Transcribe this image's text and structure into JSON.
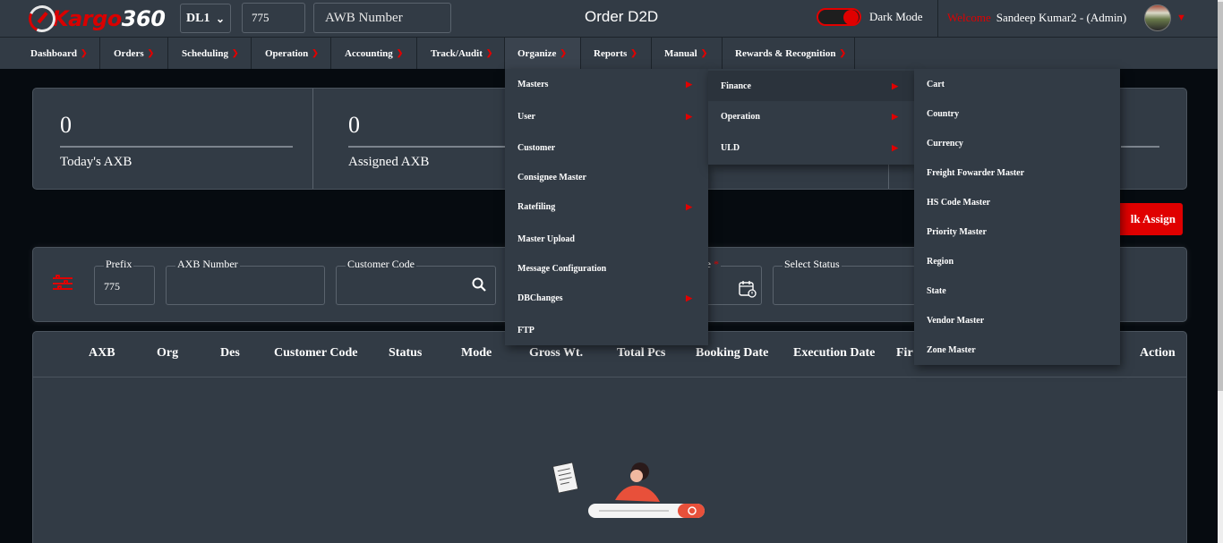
{
  "brand": {
    "logo_text_a": "Kargo",
    "logo_text_b": "360"
  },
  "header": {
    "station": "DL1",
    "prefix": "775",
    "awb_placeholder": "AWB Number",
    "page_title": "Order D2D",
    "dark_mode_label": "Dark Mode",
    "welcome": "Welcome",
    "user": "Sandeep Kumar2 - (Admin)"
  },
  "nav": [
    {
      "label": "Dashboard"
    },
    {
      "label": "Orders"
    },
    {
      "label": "Scheduling"
    },
    {
      "label": "Operation"
    },
    {
      "label": "Accounting"
    },
    {
      "label": "Track/Audit"
    },
    {
      "label": "Organize"
    },
    {
      "label": "Reports"
    },
    {
      "label": "Manual"
    },
    {
      "label": "Rewards & Recognition"
    }
  ],
  "stats": [
    {
      "value": "0",
      "label": "Today's AXB"
    },
    {
      "value": "0",
      "label": "Assigned AXB"
    }
  ],
  "bulk_assign": "lk Assign",
  "filters": {
    "prefix_label": "Prefix",
    "prefix_value": "775",
    "axb_label": "AXB Number",
    "customer_label": "Customer Code",
    "date_label": "ate",
    "required_mark": "*",
    "status_label": "Select Status"
  },
  "table": {
    "headers": [
      "AXB",
      "Org",
      "Des",
      "Customer Code",
      "Status",
      "Mode",
      "Gross Wt.",
      "Total Pcs",
      "Booking Date",
      "Execution Date",
      "Fir",
      "Action"
    ]
  },
  "menu_organize": [
    {
      "label": "Masters",
      "sub": true
    },
    {
      "label": "User",
      "sub": true
    },
    {
      "label": "Customer",
      "sub": false
    },
    {
      "label": "Consignee Master",
      "sub": false
    },
    {
      "label": "Ratefiling",
      "sub": true
    },
    {
      "label": "Master Upload",
      "sub": false
    },
    {
      "label": "Message Configuration",
      "sub": false
    },
    {
      "label": "DBChanges",
      "sub": true
    },
    {
      "label": "FTP",
      "sub": false
    }
  ],
  "menu_masters": [
    {
      "label": "Finance"
    },
    {
      "label": "Operation"
    },
    {
      "label": "ULD"
    }
  ],
  "menu_finance": [
    {
      "label": "Cart"
    },
    {
      "label": "Country"
    },
    {
      "label": "Currency"
    },
    {
      "label": "Freight Fowarder Master"
    },
    {
      "label": "HS Code Master"
    },
    {
      "label": "Priority Master"
    },
    {
      "label": "Region"
    },
    {
      "label": "State"
    },
    {
      "label": "Vendor Master"
    },
    {
      "label": "Zone Master"
    }
  ],
  "colors": {
    "accent": "#e00000",
    "panel": "#323b45",
    "background": "#060b10"
  }
}
